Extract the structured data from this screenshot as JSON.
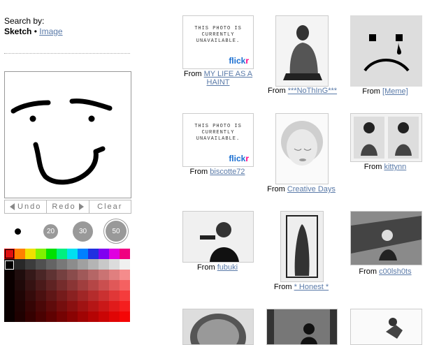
{
  "sidebar": {
    "search_by_label": "Search by:",
    "mode_active": "Sketch",
    "mode_separator": " • ",
    "mode_link": "Image",
    "toolbar": {
      "undo": "Undo",
      "redo": "Redo",
      "clear": "Clear"
    },
    "brushes": [
      "20",
      "30",
      "50"
    ],
    "selected_brush": "50",
    "current_color": "#e01010"
  },
  "results": {
    "from_label": "From",
    "unavailable_text": "THIS PHOTO IS CURRENTLY UNAVAILABLE.",
    "flickr_part1": "flick",
    "flickr_part2": "r",
    "items": [
      {
        "source": "MY LIFE AS A HAINT",
        "image": "unavailable"
      },
      {
        "source": "***NoThInG***",
        "image": "man-sitting-photo"
      },
      {
        "source": "[Meme]",
        "image": "sad-face-photo"
      },
      {
        "source": "biscotte72",
        "image": "unavailable"
      },
      {
        "source": "Creative Days",
        "image": "child-face-photo"
      },
      {
        "source": "kittynn",
        "image": "two-girls-photo"
      },
      {
        "source": "fubuki",
        "image": "man-pointing-gun-photo"
      },
      {
        "source": "* Honest *",
        "image": "woman-in-mirror-photo"
      },
      {
        "source": "c00lsh0ts",
        "image": "person-on-rooftop-photo"
      },
      {
        "source": "",
        "image": "shell-photo"
      },
      {
        "source": "",
        "image": "silhouette-photo"
      },
      {
        "source": "",
        "image": "statue-photo"
      }
    ]
  }
}
